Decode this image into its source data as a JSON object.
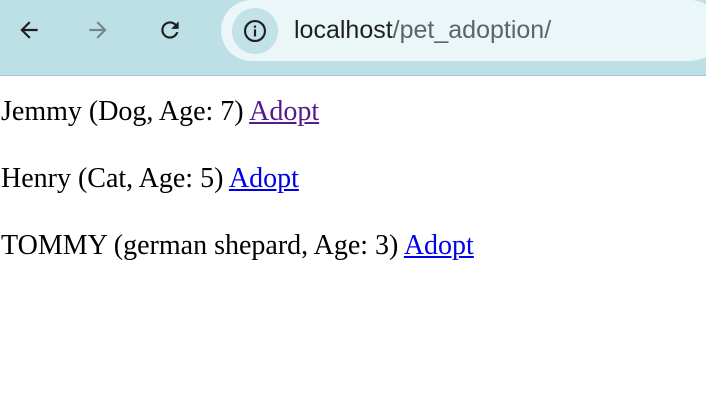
{
  "browser": {
    "url_host": "localhost",
    "url_path": "/pet_adoption/",
    "icons": {
      "back": "arrow-left-icon",
      "forward": "arrow-right-icon",
      "reload": "reload-icon",
      "site_info": "info-icon"
    }
  },
  "pets": [
    {
      "text": "Jemmy (Dog, Age: 7)",
      "link_label": "Adopt",
      "link_color": "#551a8b"
    },
    {
      "text": "Henry (Cat, Age: 5)",
      "link_label": "Adopt",
      "link_color": "#0000ee"
    },
    {
      "text": "TOMMY (german shepard, Age: 3)",
      "link_label": "Adopt",
      "link_color": "#0000ee"
    }
  ],
  "colors": {
    "toolbar": "#bde0e6",
    "omnibox": "#eaf6f7",
    "visited_link": "#551a8b",
    "link": "#0000ee"
  }
}
